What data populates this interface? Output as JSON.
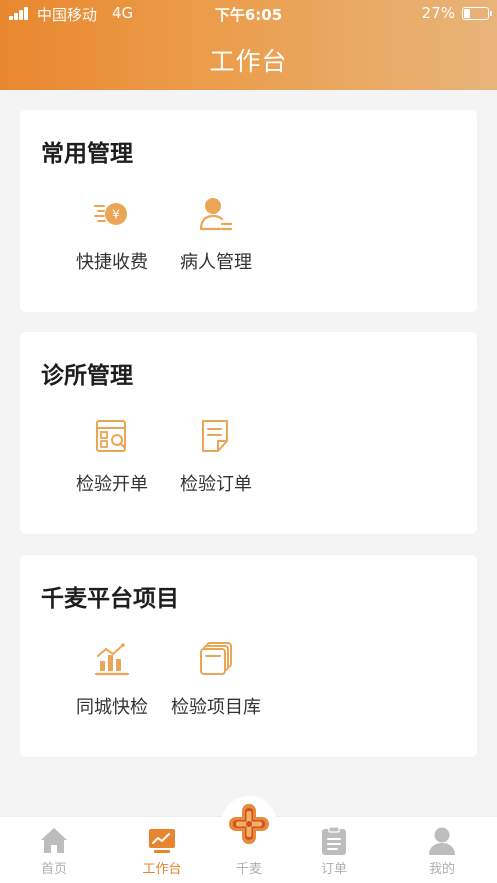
{
  "status_bar": {
    "carrier": "中国移动",
    "network": "4G",
    "time": "下午6:05",
    "battery": "27%",
    "battery_level": 0.27
  },
  "header": {
    "title": "工作台"
  },
  "sections": [
    {
      "title": "常用管理",
      "items": [
        {
          "label": "快捷收费",
          "icon": "quick-charge-icon"
        },
        {
          "label": "病人管理",
          "icon": "patient-icon"
        }
      ]
    },
    {
      "title": "诊所管理",
      "items": [
        {
          "label": "检验开单",
          "icon": "test-order-icon"
        },
        {
          "label": "检验订单",
          "icon": "order-document-icon"
        }
      ]
    },
    {
      "title": "千麦平台项目",
      "items": [
        {
          "label": "同城快检",
          "icon": "bar-chart-icon"
        },
        {
          "label": "检验项目库",
          "icon": "project-library-icon"
        }
      ]
    }
  ],
  "tabbar": {
    "tabs": [
      {
        "label": "首页",
        "icon": "home-icon"
      },
      {
        "label": "工作台",
        "icon": "workbench-icon"
      },
      {
        "label": "千麦",
        "icon": "qianmai-logo-icon"
      },
      {
        "label": "订单",
        "icon": "clipboard-icon"
      },
      {
        "label": "我的",
        "icon": "user-icon"
      }
    ],
    "active_index": 1
  },
  "colors": {
    "accent": "#e7862e",
    "inactive": "#b0b0b0",
    "background": "#f4f4f4"
  }
}
